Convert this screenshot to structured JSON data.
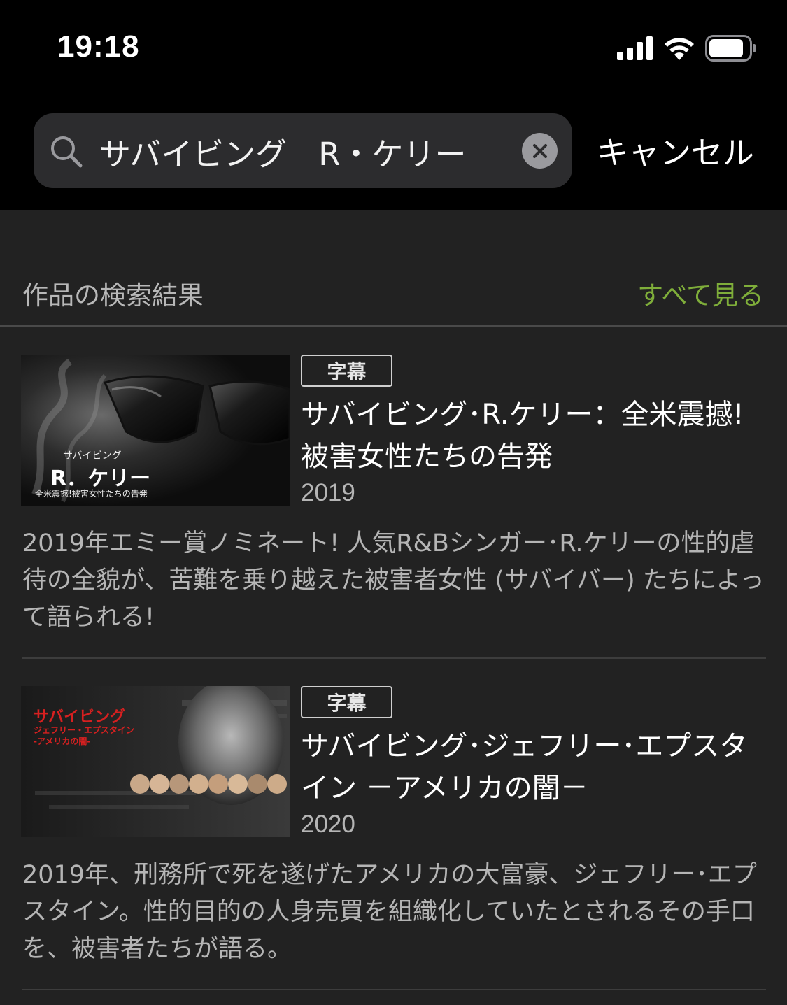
{
  "status_bar": {
    "time": "19:18",
    "icons": [
      "cellular-signal-icon",
      "wifi-icon",
      "battery-icon"
    ]
  },
  "search": {
    "query": "サバイビング　R・ケリー",
    "cancel_label": "キャンセル",
    "icons": [
      "search-icon",
      "clear-icon"
    ]
  },
  "section": {
    "title": "作品の検索結果",
    "see_all": "すべて見る"
  },
  "colors": {
    "background": "#222222",
    "header_background": "#000000",
    "accent_green": "#7fae3a",
    "secondary_text": "#b5b5b5"
  },
  "results": [
    {
      "badge": "字幕",
      "title": "サバイビング･R.ケリー：全米震撼!被害女性たちの告発",
      "year": "2019",
      "description": "2019年エミー賞ノミネート! 人気R&Bシンガー･R.ケリーの性的虐待の全貌が、苦難を乗り越えた被害者女性 (サバイバー) たちによって語られる!",
      "thumbnail": {
        "line1": "サバイビング",
        "line2": "R．ケリー",
        "line3": "全米震撼!被害女性たちの告発"
      }
    },
    {
      "badge": "字幕",
      "title": "サバイビング･ジェフリー･エプスタイン －アメリカの闇－",
      "year": "2020",
      "description": "2019年、刑務所で死を遂げたアメリカの大富豪、ジェフリー･エプスタイン。性的目的の人身売買を組織化していたとされるその手口を、被害者たちが語る。",
      "thumbnail": {
        "line1": "サバイビング",
        "line2": "ジェフリー・エプスタイン",
        "line3": "-アメリカの闇-"
      }
    }
  ]
}
